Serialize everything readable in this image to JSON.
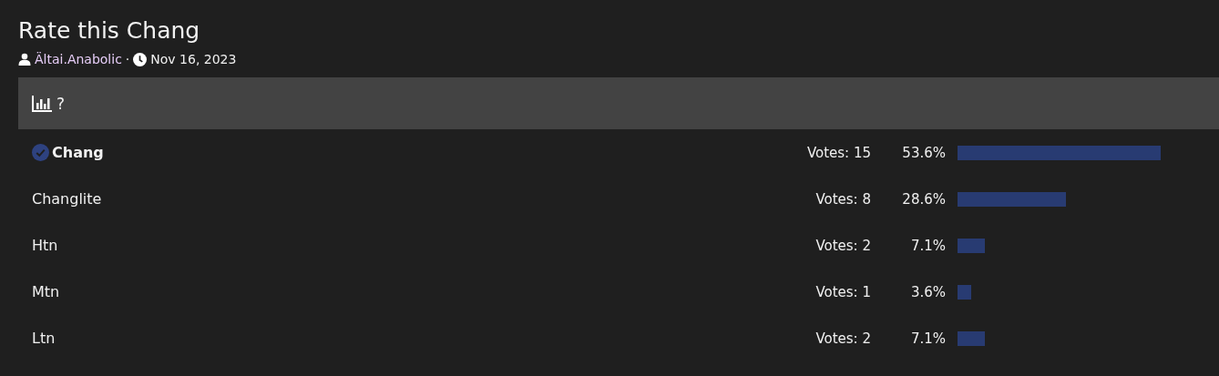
{
  "title": "Rate this Chang",
  "meta": {
    "author": "Ältai.Anabolic",
    "separator": "·",
    "date": "Nov 16, 2023"
  },
  "poll": {
    "question": "?",
    "options": [
      {
        "label": "Chang",
        "selected": true,
        "votes": "Votes: 15",
        "percent": "53.6%"
      },
      {
        "label": "Changlite",
        "selected": false,
        "votes": "Votes: 8",
        "percent": "28.6%"
      },
      {
        "label": "Htn",
        "selected": false,
        "votes": "Votes: 2",
        "percent": "7.1%"
      },
      {
        "label": "Mtn",
        "selected": false,
        "votes": "Votes: 1",
        "percent": "3.6%"
      },
      {
        "label": "Ltn",
        "selected": false,
        "votes": "Votes: 2",
        "percent": "7.1%"
      }
    ]
  }
}
